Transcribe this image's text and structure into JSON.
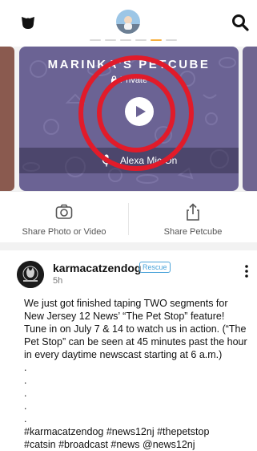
{
  "header": {
    "left_icon": "cat-face-icon",
    "avatar": "profile-avatar",
    "search_icon": "search-icon",
    "pager_count": 6,
    "pager_active_index": 4
  },
  "camera_card": {
    "title": "MARINKA'S PETCUBE",
    "privacy_label": "Private",
    "lock_icon": "lock-icon",
    "play_icon": "play-icon",
    "mic_icon": "microphone-icon",
    "alexa_label": "Alexa Mic On",
    "card_color": "#6b6394",
    "highlight_color": "#e11b2a"
  },
  "share": {
    "photo_label": "Share Photo or Video",
    "photo_icon": "camera-icon",
    "petcube_label": "Share Petcube",
    "petcube_icon": "share-icon"
  },
  "post": {
    "author": "karmacatzendog",
    "badge": "Rescue",
    "time": "5h",
    "body": "We just got finished taping TWO segments for New Jersey 12 News’ “The Pet Stop” feature! Tune in on July 7 & 14 to watch us in action. (“The Pet Stop” can be seen at 45 minutes past the hour in every daytime newscast starting at 6 a.m.)\n.\n.\n.\n.\n.\n#karmacatzendog #news12nj #thepetstop\n#catsin #broadcast #news @news12nj",
    "more_icon": "more-vertical-icon"
  }
}
